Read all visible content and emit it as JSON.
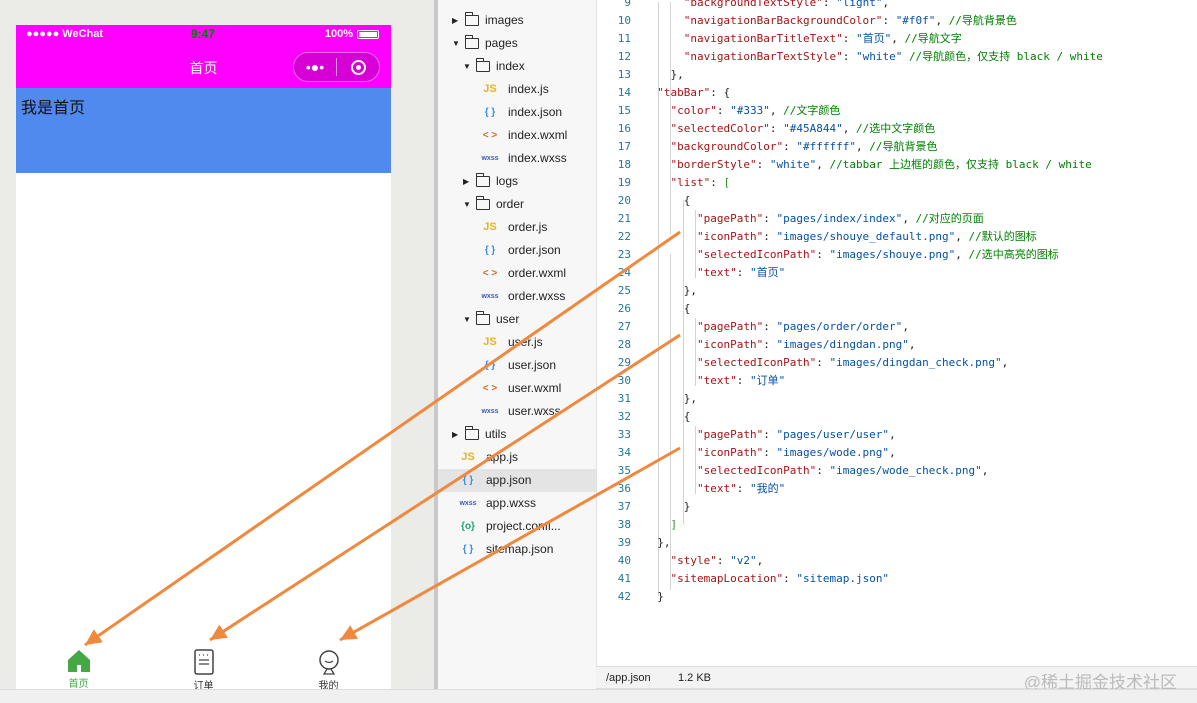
{
  "phone": {
    "status": {
      "carrier": "●●●●● WeChat",
      "time": "9:47",
      "battery": "100%"
    },
    "nav_title": "首页",
    "capsule_more": "•●•",
    "content_text": "我是首页",
    "tabs": [
      {
        "label": "首页",
        "icon": "home-icon",
        "selected": true
      },
      {
        "label": "订单",
        "icon": "order-icon",
        "selected": false
      },
      {
        "label": "我的",
        "icon": "user-icon",
        "selected": false
      }
    ],
    "colors": {
      "nav": "#ff00ff",
      "content": "#518aee",
      "tab_selected": "#45A844",
      "tab_text": "#333333"
    }
  },
  "tree": [
    {
      "label": "images",
      "type": "folder",
      "open": false,
      "depth": 0
    },
    {
      "label": "pages",
      "type": "folder",
      "open": true,
      "depth": 0
    },
    {
      "label": "index",
      "type": "folder",
      "open": true,
      "depth": 1
    },
    {
      "label": "index.js",
      "type": "js",
      "depth": 2
    },
    {
      "label": "index.json",
      "type": "json",
      "depth": 2
    },
    {
      "label": "index.wxml",
      "type": "wxml",
      "depth": 2
    },
    {
      "label": "index.wxss",
      "type": "wxss",
      "depth": 2
    },
    {
      "label": "logs",
      "type": "folder",
      "open": false,
      "depth": 1
    },
    {
      "label": "order",
      "type": "folder",
      "open": true,
      "depth": 1
    },
    {
      "label": "order.js",
      "type": "js",
      "depth": 2
    },
    {
      "label": "order.json",
      "type": "json",
      "depth": 2
    },
    {
      "label": "order.wxml",
      "type": "wxml",
      "depth": 2
    },
    {
      "label": "order.wxss",
      "type": "wxss",
      "depth": 2
    },
    {
      "label": "user",
      "type": "folder",
      "open": true,
      "depth": 1
    },
    {
      "label": "user.js",
      "type": "js",
      "depth": 2
    },
    {
      "label": "user.json",
      "type": "json",
      "depth": 2
    },
    {
      "label": "user.wxml",
      "type": "wxml",
      "depth": 2
    },
    {
      "label": "user.wxss",
      "type": "wxss",
      "depth": 2
    },
    {
      "label": "utils",
      "type": "folder",
      "open": false,
      "depth": 0
    },
    {
      "label": "app.js",
      "type": "js",
      "depth": 0
    },
    {
      "label": "app.json",
      "type": "json",
      "depth": 0,
      "active": true
    },
    {
      "label": "app.wxss",
      "type": "wxss",
      "depth": 0
    },
    {
      "label": "project.confi...",
      "type": "cfg",
      "depth": 0
    },
    {
      "label": "sitemap.json",
      "type": "json",
      "depth": 0
    }
  ],
  "icon_glyphs": {
    "js": "JS",
    "json": "{ }",
    "wxml": "< >",
    "wxss": "wxss",
    "cfg": "{o}"
  },
  "code": [
    {
      "n": 9,
      "t": [
        [
          "p",
          "      "
        ],
        [
          "k",
          "\"backgroundTextStyle\""
        ],
        [
          "p",
          ": "
        ],
        [
          "s",
          "\"light\""
        ],
        [
          "p",
          ","
        ]
      ]
    },
    {
      "n": 10,
      "t": [
        [
          "p",
          "      "
        ],
        [
          "k",
          "\"navigationBarBackgroundColor\""
        ],
        [
          "p",
          ": "
        ],
        [
          "s",
          "\"#f0f\""
        ],
        [
          "p",
          ", "
        ],
        [
          "c",
          "//导航背景色"
        ]
      ]
    },
    {
      "n": 11,
      "t": [
        [
          "p",
          "      "
        ],
        [
          "k",
          "\"navigationBarTitleText\""
        ],
        [
          "p",
          ": "
        ],
        [
          "s",
          "\"首页\""
        ],
        [
          "p",
          ", "
        ],
        [
          "c",
          "//导航文字"
        ]
      ]
    },
    {
      "n": 12,
      "t": [
        [
          "p",
          "      "
        ],
        [
          "k",
          "\"navigationBarTextStyle\""
        ],
        [
          "p",
          ": "
        ],
        [
          "s",
          "\"white\""
        ],
        [
          "p",
          " "
        ],
        [
          "c",
          "//导航颜色，仅支持 black / white"
        ]
      ]
    },
    {
      "n": 13,
      "t": [
        [
          "p",
          "    },"
        ]
      ]
    },
    {
      "n": 14,
      "t": [
        [
          "p",
          "  "
        ],
        [
          "k",
          "\"tabBar\""
        ],
        [
          "p",
          ": {"
        ]
      ]
    },
    {
      "n": 15,
      "t": [
        [
          "p",
          "    "
        ],
        [
          "k",
          "\"color\""
        ],
        [
          "p",
          ": "
        ],
        [
          "s",
          "\"#333\""
        ],
        [
          "p",
          ", "
        ],
        [
          "c",
          "//文字颜色"
        ]
      ]
    },
    {
      "n": 16,
      "t": [
        [
          "p",
          "    "
        ],
        [
          "k",
          "\"selectedColor\""
        ],
        [
          "p",
          ": "
        ],
        [
          "s",
          "\"#45A844\""
        ],
        [
          "p",
          ", "
        ],
        [
          "c",
          "//选中文字颜色"
        ]
      ]
    },
    {
      "n": 17,
      "t": [
        [
          "p",
          "    "
        ],
        [
          "k",
          "\"backgroundColor\""
        ],
        [
          "p",
          ": "
        ],
        [
          "s",
          "\"#ffffff\""
        ],
        [
          "p",
          ", "
        ],
        [
          "c",
          "//导航背景色"
        ]
      ]
    },
    {
      "n": 18,
      "t": [
        [
          "p",
          "    "
        ],
        [
          "k",
          "\"borderStyle\""
        ],
        [
          "p",
          ": "
        ],
        [
          "s",
          "\"white\""
        ],
        [
          "p",
          ", "
        ],
        [
          "c",
          "//tabbar 上边框的颜色，仅支持 black / white"
        ]
      ]
    },
    {
      "n": 19,
      "t": [
        [
          "p",
          "    "
        ],
        [
          "k",
          "\"list\""
        ],
        [
          "p",
          ": "
        ],
        [
          "b",
          "["
        ]
      ]
    },
    {
      "n": 20,
      "t": [
        [
          "p",
          "      {"
        ]
      ]
    },
    {
      "n": 21,
      "t": [
        [
          "p",
          "        "
        ],
        [
          "k",
          "\"pagePath\""
        ],
        [
          "p",
          ": "
        ],
        [
          "s",
          "\"pages/index/index\""
        ],
        [
          "p",
          ", "
        ],
        [
          "c",
          "//对应的页面"
        ]
      ]
    },
    {
      "n": 22,
      "t": [
        [
          "p",
          "        "
        ],
        [
          "k",
          "\"iconPath\""
        ],
        [
          "p",
          ": "
        ],
        [
          "s",
          "\"images/shouye_default.png\""
        ],
        [
          "p",
          ", "
        ],
        [
          "c",
          "//默认的图标"
        ]
      ]
    },
    {
      "n": 23,
      "t": [
        [
          "p",
          "        "
        ],
        [
          "k",
          "\"selectedIconPath\""
        ],
        [
          "p",
          ": "
        ],
        [
          "s",
          "\"images/shouye.png\""
        ],
        [
          "p",
          ", "
        ],
        [
          "c",
          "//选中高亮的图标"
        ]
      ]
    },
    {
      "n": 24,
      "t": [
        [
          "p",
          "        "
        ],
        [
          "k",
          "\"text\""
        ],
        [
          "p",
          ": "
        ],
        [
          "s",
          "\"首页\""
        ]
      ]
    },
    {
      "n": 25,
      "t": [
        [
          "p",
          "      },"
        ]
      ]
    },
    {
      "n": 26,
      "t": [
        [
          "p",
          "      {"
        ]
      ]
    },
    {
      "n": 27,
      "t": [
        [
          "p",
          "        "
        ],
        [
          "k",
          "\"pagePath\""
        ],
        [
          "p",
          ": "
        ],
        [
          "s",
          "\"pages/order/order\""
        ],
        [
          "p",
          ","
        ]
      ]
    },
    {
      "n": 28,
      "t": [
        [
          "p",
          "        "
        ],
        [
          "k",
          "\"iconPath\""
        ],
        [
          "p",
          ": "
        ],
        [
          "s",
          "\"images/dingdan.png\""
        ],
        [
          "p",
          ","
        ]
      ]
    },
    {
      "n": 29,
      "t": [
        [
          "p",
          "        "
        ],
        [
          "k",
          "\"selectedIconPath\""
        ],
        [
          "p",
          ": "
        ],
        [
          "s",
          "\"images/dingdan_check.png\""
        ],
        [
          "p",
          ","
        ]
      ]
    },
    {
      "n": 30,
      "t": [
        [
          "p",
          "        "
        ],
        [
          "k",
          "\"text\""
        ],
        [
          "p",
          ": "
        ],
        [
          "s",
          "\"订单\""
        ]
      ]
    },
    {
      "n": 31,
      "t": [
        [
          "p",
          "      },"
        ]
      ]
    },
    {
      "n": 32,
      "t": [
        [
          "p",
          "      {"
        ]
      ]
    },
    {
      "n": 33,
      "t": [
        [
          "p",
          "        "
        ],
        [
          "k",
          "\"pagePath\""
        ],
        [
          "p",
          ": "
        ],
        [
          "s",
          "\"pages/user/user\""
        ],
        [
          "p",
          ","
        ]
      ]
    },
    {
      "n": 34,
      "t": [
        [
          "p",
          "        "
        ],
        [
          "k",
          "\"iconPath\""
        ],
        [
          "p",
          ": "
        ],
        [
          "s",
          "\"images/wode.png\""
        ],
        [
          "p",
          ","
        ]
      ]
    },
    {
      "n": 35,
      "t": [
        [
          "p",
          "        "
        ],
        [
          "k",
          "\"selectedIconPath\""
        ],
        [
          "p",
          ": "
        ],
        [
          "s",
          "\"images/wode_check.png\""
        ],
        [
          "p",
          ","
        ]
      ]
    },
    {
      "n": 36,
      "t": [
        [
          "p",
          "        "
        ],
        [
          "k",
          "\"text\""
        ],
        [
          "p",
          ": "
        ],
        [
          "s",
          "\"我的\""
        ]
      ]
    },
    {
      "n": 37,
      "t": [
        [
          "p",
          "      }"
        ]
      ]
    },
    {
      "n": 38,
      "t": [
        [
          "p",
          "    "
        ],
        [
          "b",
          "]"
        ]
      ]
    },
    {
      "n": 39,
      "t": [
        [
          "p",
          "  },"
        ]
      ]
    },
    {
      "n": 40,
      "t": [
        [
          "p",
          "    "
        ],
        [
          "k",
          "\"style\""
        ],
        [
          "p",
          ": "
        ],
        [
          "s",
          "\"v2\""
        ],
        [
          "p",
          ","
        ]
      ]
    },
    {
      "n": 41,
      "t": [
        [
          "p",
          "    "
        ],
        [
          "k",
          "\"sitemapLocation\""
        ],
        [
          "p",
          ": "
        ],
        [
          "s",
          "\"sitemap.json\""
        ]
      ]
    },
    {
      "n": 42,
      "t": [
        [
          "p",
          "  }"
        ]
      ]
    }
  ],
  "editor_status": {
    "path": "/app.json",
    "size": "1.2 KB",
    "watermark": "@稀土掘金技术社区"
  },
  "annotation_color": "#f0883e"
}
